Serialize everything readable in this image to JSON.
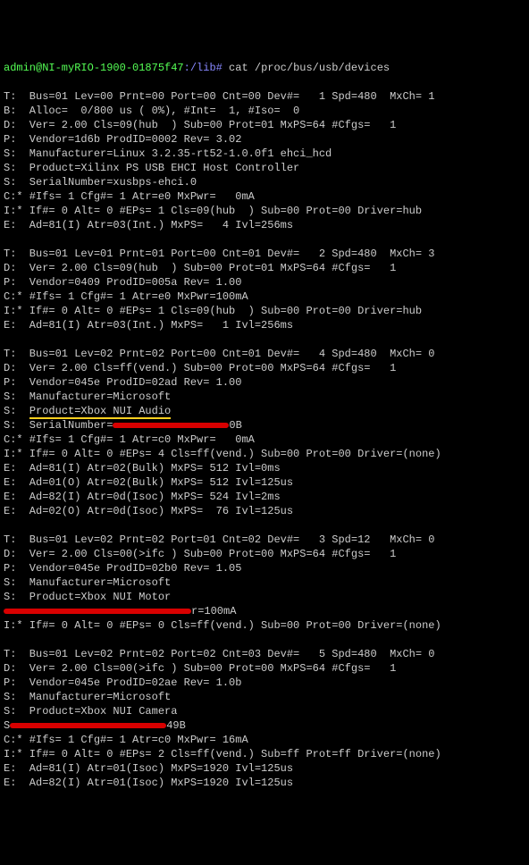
{
  "prompt": {
    "user_host": "admin@NI-myRIO-1900-01875f47",
    "path": ":/lib#",
    "cmd": " cat /proc/bus/usb/devices"
  },
  "dev1": {
    "t": "T:  Bus=01 Lev=00 Prnt=00 Port=00 Cnt=00 Dev#=   1 Spd=480  MxCh= 1",
    "b": "B:  Alloc=  0/800 us ( 0%), #Int=  1, #Iso=  0",
    "d": "D:  Ver= 2.00 Cls=09(hub  ) Sub=00 Prot=01 MxPS=64 #Cfgs=   1",
    "p": "P:  Vendor=1d6b ProdID=0002 Rev= 3.02",
    "s1": "S:  Manufacturer=Linux 3.2.35-rt52-1.0.0f1 ehci_hcd",
    "s2": "S:  Product=Xilinx PS USB EHCI Host Controller",
    "s3": "S:  SerialNumber=xusbps-ehci.0",
    "c": "C:* #Ifs= 1 Cfg#= 1 Atr=e0 MxPwr=   0mA",
    "i": "I:* If#= 0 Alt= 0 #EPs= 1 Cls=09(hub  ) Sub=00 Prot=00 Driver=hub",
    "e": "E:  Ad=81(I) Atr=03(Int.) MxPS=   4 Ivl=256ms"
  },
  "dev2": {
    "t": "T:  Bus=01 Lev=01 Prnt=01 Port=00 Cnt=01 Dev#=   2 Spd=480  MxCh= 3",
    "d": "D:  Ver= 2.00 Cls=09(hub  ) Sub=00 Prot=01 MxPS=64 #Cfgs=   1",
    "p": "P:  Vendor=0409 ProdID=005a Rev= 1.00",
    "c": "C:* #Ifs= 1 Cfg#= 1 Atr=e0 MxPwr=100mA",
    "i": "I:* If#= 0 Alt= 0 #EPs= 1 Cls=09(hub  ) Sub=00 Prot=00 Driver=hub",
    "e": "E:  Ad=81(I) Atr=03(Int.) MxPS=   1 Ivl=256ms"
  },
  "dev3": {
    "t": "T:  Bus=01 Lev=02 Prnt=02 Port=00 Cnt=01 Dev#=   4 Spd=480  MxCh= 0",
    "d": "D:  Ver= 2.00 Cls=ff(vend.) Sub=00 Prot=00 MxPS=64 #Cfgs=   1",
    "p": "P:  Vendor=045e ProdID=02ad Rev= 1.00",
    "s1": "S:  Manufacturer=Microsoft",
    "s2pre": "S:  ",
    "s2prod": "Product=Xbox NUI Audio",
    "s3pre": "S:  SerialNumber=",
    "s3post": "0B",
    "c": "C:* #Ifs= 1 Cfg#= 1 Atr=c0 MxPwr=   0mA",
    "i": "I:* If#= 0 Alt= 0 #EPs= 4 Cls=ff(vend.) Sub=00 Prot=00 Driver=(none)",
    "e1": "E:  Ad=81(I) Atr=02(Bulk) MxPS= 512 Ivl=0ms",
    "e2": "E:  Ad=01(O) Atr=02(Bulk) MxPS= 512 Ivl=125us",
    "e3": "E:  Ad=82(I) Atr=0d(Isoc) MxPS= 524 Ivl=2ms",
    "e4": "E:  Ad=02(O) Atr=0d(Isoc) MxPS=  76 Ivl=125us"
  },
  "dev4": {
    "t": "T:  Bus=01 Lev=02 Prnt=02 Port=01 Cnt=02 Dev#=   3 Spd=12   MxCh= 0",
    "d": "D:  Ver= 2.00 Cls=00(>ifc ) Sub=00 Prot=00 MxPS=64 #Cfgs=   1",
    "p": "P:  Vendor=045e ProdID=02b0 Rev= 1.05",
    "s1": "S:  Manufacturer=Microsoft",
    "s2": "S:  Product=Xbox NUI Motor",
    "cpost": "r=100mA",
    "i": "I:* If#= 0 Alt= 0 #EPs= 0 Cls=ff(vend.) Sub=00 Prot=00 Driver=(none)"
  },
  "dev5": {
    "t": "T:  Bus=01 Lev=02 Prnt=02 Port=02 Cnt=03 Dev#=   5 Spd=480  MxCh= 0",
    "d": "D:  Ver= 2.00 Cls=00(>ifc ) Sub=00 Prot=00 MxPS=64 #Cfgs=   1",
    "p": "P:  Vendor=045e ProdID=02ae Rev= 1.0b",
    "s1": "S:  Manufacturer=Microsoft",
    "s2": "S:  Product=Xbox NUI Camera",
    "s3pre": "S",
    "s3post": "49B",
    "c": "C:* #Ifs= 1 Cfg#= 1 Atr=c0 MxPwr= 16mA",
    "i": "I:* If#= 0 Alt= 0 #EPs= 2 Cls=ff(vend.) Sub=ff Prot=ff Driver=(none)",
    "e1": "E:  Ad=81(I) Atr=01(Isoc) MxPS=1920 Ivl=125us",
    "e2": "E:  Ad=82(I) Atr=01(Isoc) MxPS=1920 Ivl=125us"
  }
}
